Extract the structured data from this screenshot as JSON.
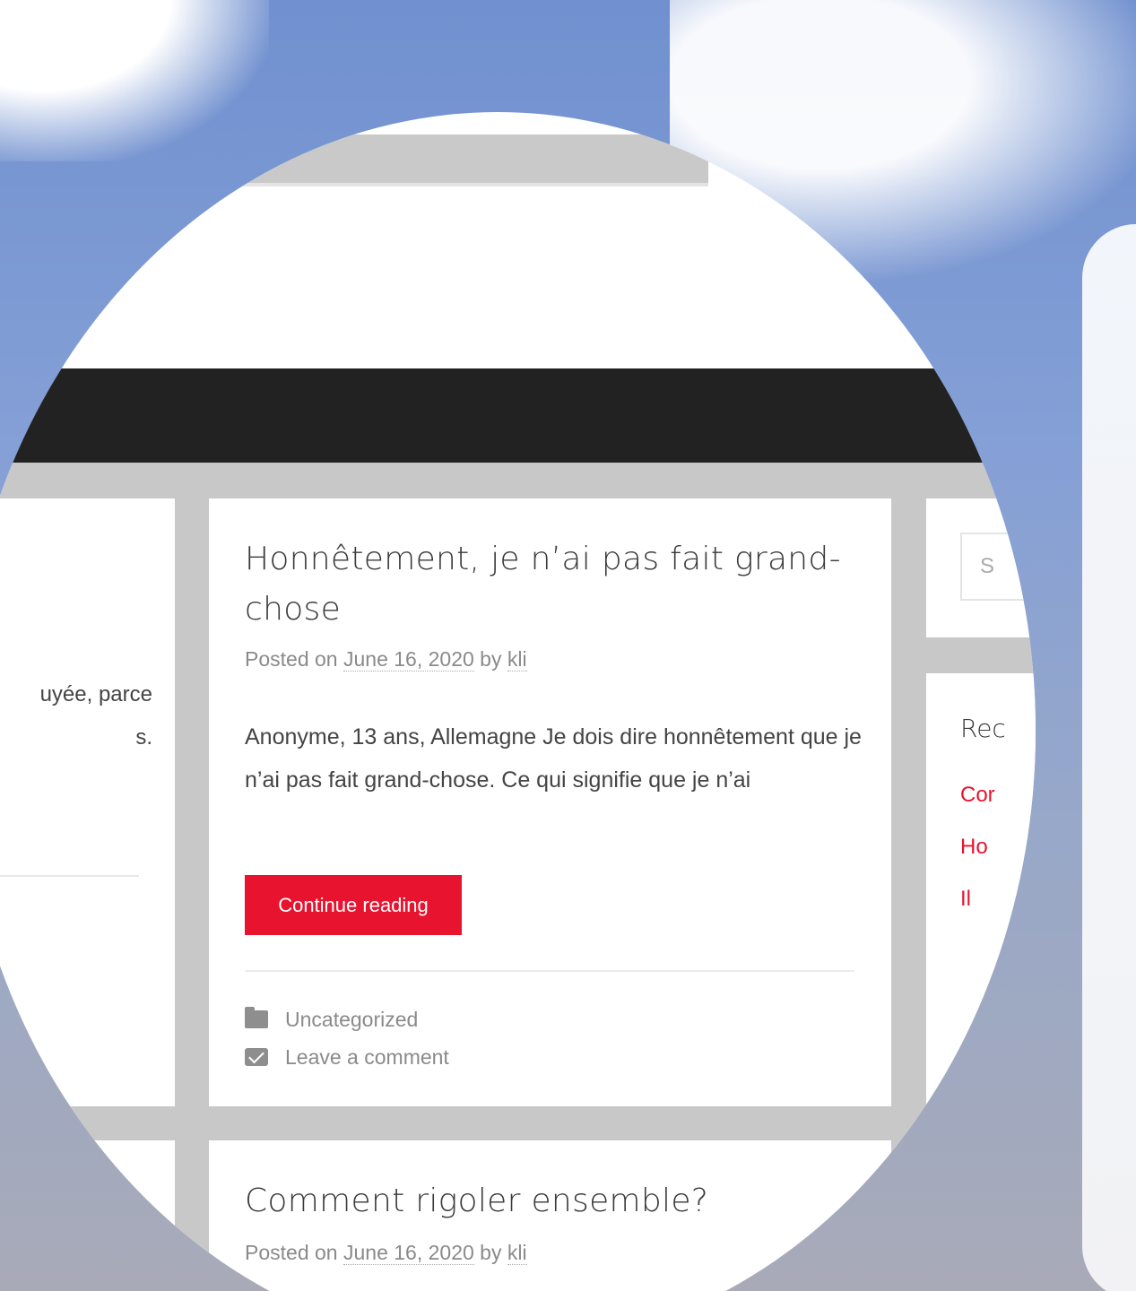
{
  "left_column": {
    "snippet_line1": "uyée, parce",
    "snippet_line2": "s.",
    "snippet_fragment": "¬"
  },
  "main_post": {
    "title": "Honnêtement, je n’ai pas fait grand-chose",
    "meta_prefix": "Posted on",
    "date": "June 16, 2020",
    "meta_by": "by",
    "author": "kli",
    "excerpt": "Anonyme, 13 ans, Allemagne Je dois dire honnêtement que je n’ai pas fait grand-chose. Ce qui signifie que je n’ai",
    "continue_label": "Continue reading",
    "category": "Uncategorized",
    "comment_link": "Leave a comment"
  },
  "next_post": {
    "title": "Comment rigoler ensemble?",
    "meta_prefix": "Posted on",
    "date": "June 16, 2020",
    "meta_by": "by",
    "author": "kli"
  },
  "sidebar": {
    "search_placeholder": "S",
    "recent_title": "Rec",
    "recent_items": [
      "Cor",
      "Ho",
      "Il"
    ]
  },
  "colors": {
    "accent": "#e8132e",
    "header": "#222222",
    "page_bg": "#c8c8c8"
  }
}
